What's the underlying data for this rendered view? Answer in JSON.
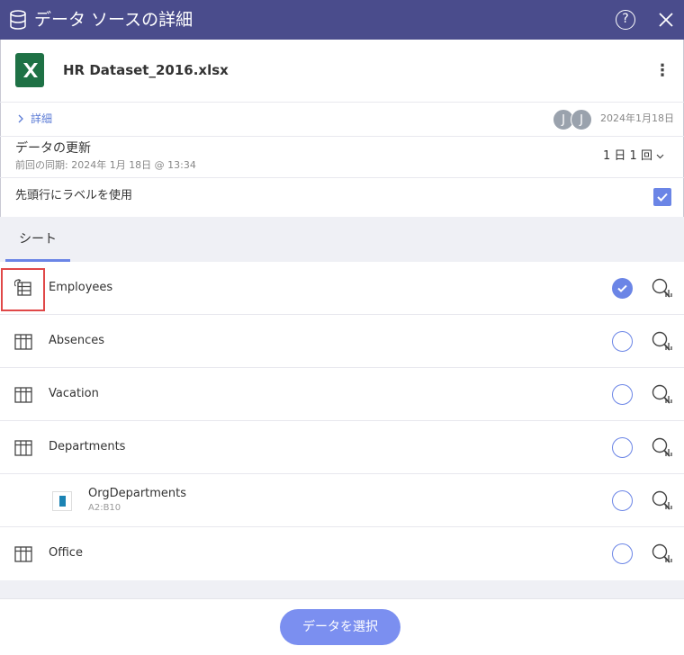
{
  "window": {
    "title": "データ ソースの詳細",
    "help_label": "?"
  },
  "file": {
    "name": "HR Dataset_2016.xlsx",
    "menu_label": "⋮"
  },
  "details": {
    "link_label": "詳細",
    "avatars": [
      "J",
      "J"
    ],
    "date": "2024年1月18日"
  },
  "refresh": {
    "title": "データの更新",
    "last_sync": "前回の同期: 2024年 1月 18日 @ 13:34",
    "frequency": "1 日 1 回"
  },
  "first_row_label": {
    "text": "先頭行にラベルを使用",
    "checked": true
  },
  "tabs": [
    {
      "label": "シート",
      "active": true
    }
  ],
  "sheets": [
    {
      "name": "Employees",
      "selected": true
    },
    {
      "name": "Absences",
      "selected": false
    },
    {
      "name": "Vacation",
      "selected": false
    },
    {
      "name": "Departments",
      "selected": false
    },
    {
      "name": "OrgDepartments",
      "range": "A2:B10",
      "selected": false
    },
    {
      "name": "Office",
      "selected": false
    }
  ],
  "footer": {
    "select_button": "データを選択"
  },
  "colors": {
    "titlebar": "#4a4c8c",
    "accent": "#6b85e6",
    "button": "#7b8ff0",
    "excel_green": "#1e7145",
    "highlight": "#e04848"
  }
}
